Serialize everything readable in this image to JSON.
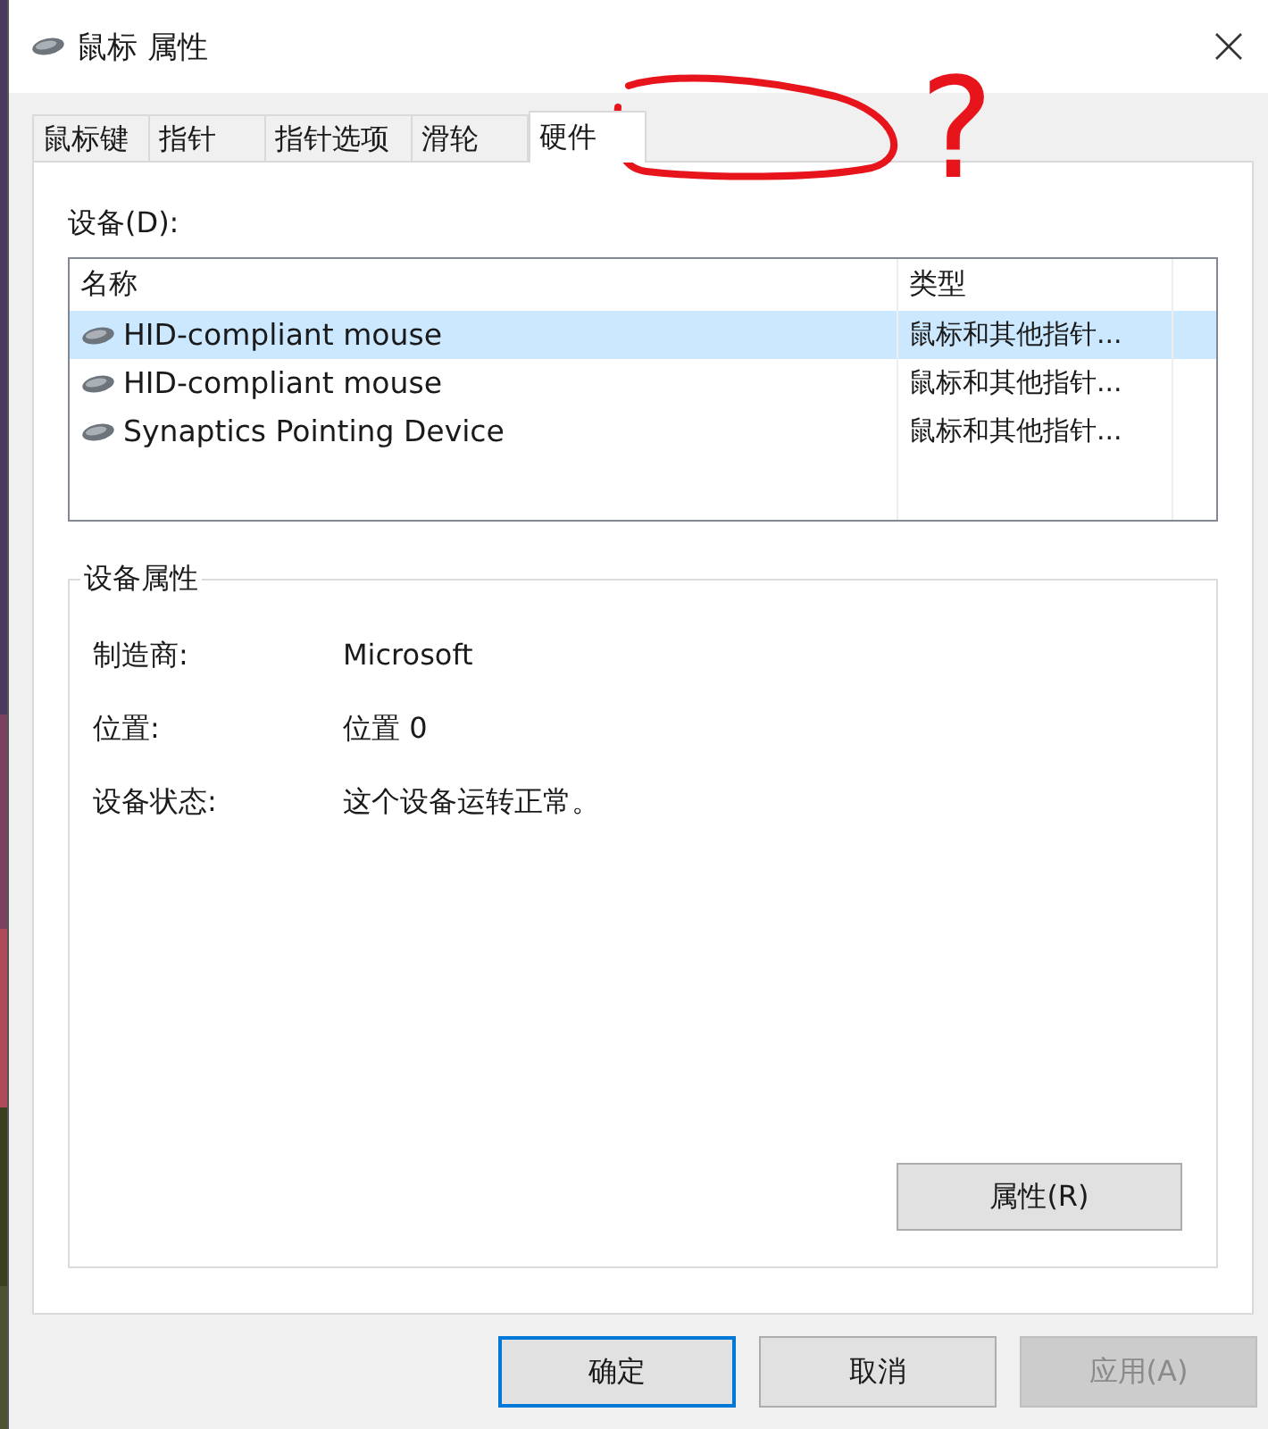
{
  "window": {
    "title": "鼠标 属性"
  },
  "tabs": [
    {
      "label": "鼠标键",
      "selected": false
    },
    {
      "label": "指针",
      "selected": false
    },
    {
      "label": "指针选项",
      "selected": false
    },
    {
      "label": "滑轮",
      "selected": false
    },
    {
      "label": "硬件",
      "selected": true
    }
  ],
  "devices": {
    "label": "设备(D):",
    "columns": [
      "名称",
      "类型"
    ],
    "rows": [
      {
        "name": "HID-compliant mouse",
        "type": "鼠标和其他指针...",
        "selected": true
      },
      {
        "name": "HID-compliant mouse",
        "type": "鼠标和其他指针...",
        "selected": false
      },
      {
        "name": "Synaptics Pointing Device",
        "type": "鼠标和其他指针...",
        "selected": false
      }
    ]
  },
  "device_properties": {
    "title": "设备属性",
    "fields": [
      {
        "label": "制造商:",
        "value": "Microsoft"
      },
      {
        "label": "位置:",
        "value": "位置 0"
      },
      {
        "label": "设备状态:",
        "value": "这个设备运转正常。"
      }
    ],
    "button": "属性(R)"
  },
  "buttons": [
    {
      "label": "确定",
      "kind": "default",
      "disabled": false
    },
    {
      "label": "取消",
      "kind": "normal",
      "disabled": false
    },
    {
      "label": "应用(A)",
      "kind": "normal",
      "disabled": true
    }
  ],
  "annotation": {
    "mark": "?"
  }
}
